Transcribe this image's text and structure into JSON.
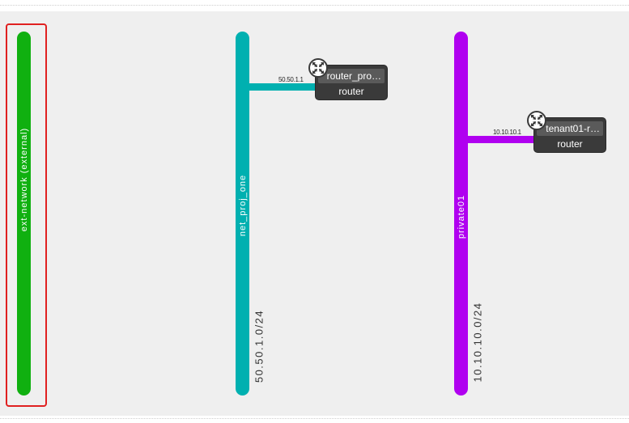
{
  "topology": {
    "networks": [
      {
        "id": "ext-network",
        "name": "ext-network (external)",
        "cidr": "",
        "color": "#10b010",
        "selected": true
      },
      {
        "id": "net-proj-one",
        "name": "net_proj_one",
        "cidr": "50.50.1.0/24",
        "color": "#00b0b0"
      },
      {
        "id": "private01",
        "name": "private01",
        "cidr": "10.10.10.0/24",
        "color": "#b000f0"
      }
    ],
    "routers": [
      {
        "id": "router-proj",
        "name": "router_pro…",
        "type": "router",
        "ip": "50.50.1.1",
        "network": "net_proj_one",
        "icon": "router-icon"
      },
      {
        "id": "tenant01-router",
        "name": "tenant01-r…",
        "type": "router",
        "ip": "10.10.10.1",
        "network": "private01",
        "icon": "router-icon"
      }
    ]
  }
}
